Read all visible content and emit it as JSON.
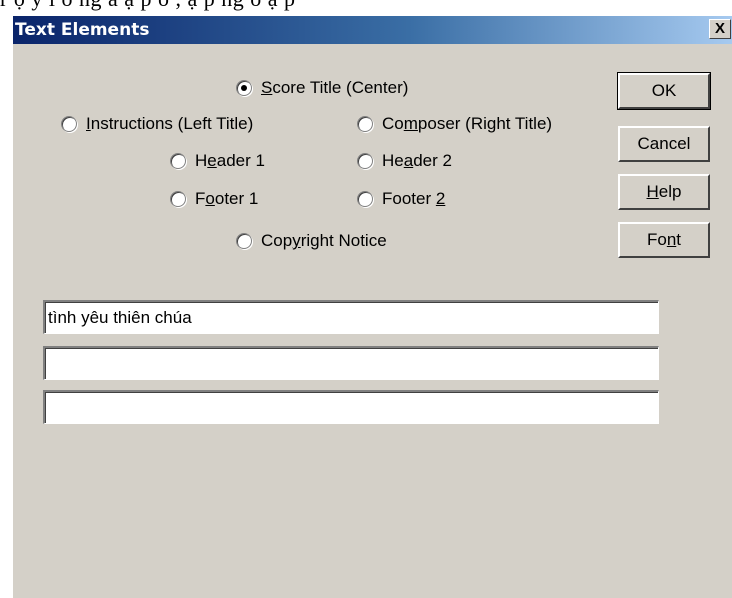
{
  "background_fragment": "r ộ  y  i ố ng     ắ  ạ p  ố ,   ạ p   ng  ố    ạ p",
  "window": {
    "title": "Text Elements",
    "close_label": "X"
  },
  "radios": {
    "score_title": {
      "pre": "",
      "mn": "S",
      "post": "core Title (Center)",
      "selected": true
    },
    "instructions": {
      "pre": "",
      "mn": "I",
      "post": "nstructions (Left Title)",
      "selected": false
    },
    "composer": {
      "pre": "Co",
      "mn": "m",
      "post": "poser (Right Title)",
      "selected": false
    },
    "header1": {
      "pre": "H",
      "mn": "e",
      "post": "ader 1",
      "selected": false
    },
    "header2": {
      "pre": "He",
      "mn": "a",
      "post": "der 2",
      "selected": false
    },
    "footer1": {
      "pre": "F",
      "mn": "o",
      "post": "oter 1",
      "selected": false
    },
    "footer2": {
      "pre": "Footer ",
      "mn": "2",
      "post": "",
      "selected": false
    },
    "copyright": {
      "pre": "Cop",
      "mn": "y",
      "post": "right Notice",
      "selected": false
    }
  },
  "buttons": {
    "ok": {
      "pre": "OK",
      "mn": "",
      "post": ""
    },
    "cancel": {
      "pre": "Cancel",
      "mn": "",
      "post": ""
    },
    "help": {
      "pre": "",
      "mn": "H",
      "post": "elp"
    },
    "font": {
      "pre": "Fo",
      "mn": "n",
      "post": "t"
    }
  },
  "fields": {
    "line1": "tình yêu thiên chúa",
    "line2": "",
    "line3": ""
  }
}
